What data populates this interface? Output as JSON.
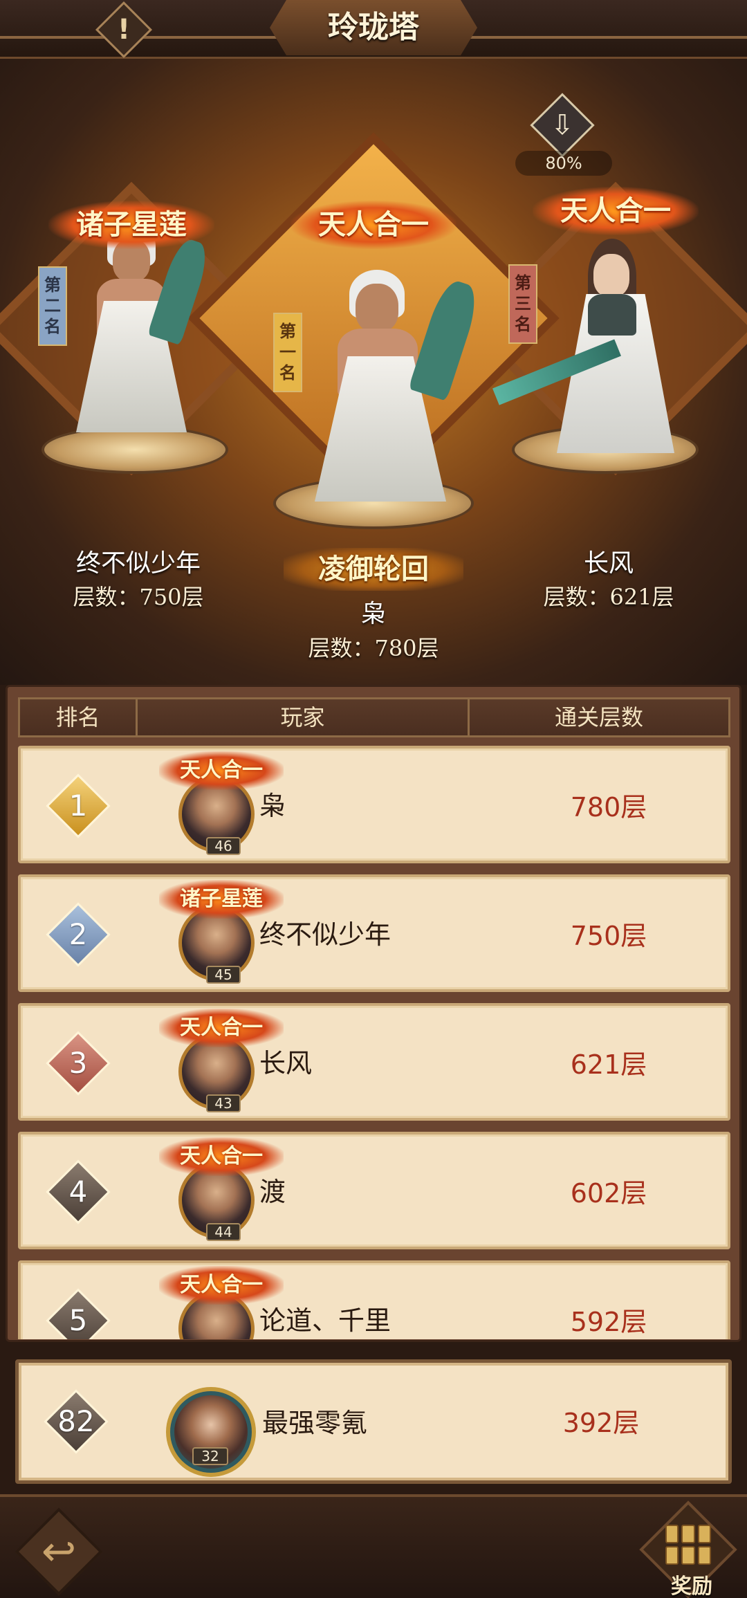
{
  "header": {
    "title": "玲珑塔",
    "alert_icon": "exclamation-icon"
  },
  "podium": {
    "progress_label": "80%",
    "progress_value": 80,
    "arrow_icon": "download-arrow-icon",
    "first": {
      "rank_tag": "第一名",
      "badge": "天人合一",
      "title_banner": "凌御轮回",
      "name": "枭",
      "floors": "层数：780层"
    },
    "second": {
      "rank_tag": "第二名",
      "badge": "诸子星莲",
      "name": "终不似少年",
      "floors": "层数：750层"
    },
    "third": {
      "rank_tag": "第三名",
      "badge": "天人合一",
      "name": "长风",
      "floors": "层数：621层"
    }
  },
  "table": {
    "headers": {
      "rank": "排名",
      "player": "玩家",
      "floors": "通关层数"
    },
    "rows": [
      {
        "rank": "1",
        "badge_style": "gold",
        "title": "天人合一",
        "level": "46",
        "name": "枭",
        "floors": "780层"
      },
      {
        "rank": "2",
        "badge_style": "blue",
        "title": "诸子星莲",
        "level": "45",
        "name": "终不似少年",
        "floors": "750层"
      },
      {
        "rank": "3",
        "badge_style": "red",
        "title": "天人合一",
        "level": "43",
        "name": "长风",
        "floors": "621层"
      },
      {
        "rank": "4",
        "badge_style": "grey",
        "title": "天人合一",
        "level": "44",
        "name": "渡",
        "floors": "602层"
      },
      {
        "rank": "5",
        "badge_style": "grey",
        "title": "天人合一",
        "level": "",
        "name": "论道、千里",
        "floors": "592层"
      }
    ]
  },
  "my_rank": {
    "rank": "82",
    "level": "32",
    "name": "最强零氪",
    "floors": "392层"
  },
  "footer": {
    "back_icon": "back-arrow-icon",
    "reward_icon": "treasure-icon",
    "reward_label": "奖励"
  },
  "colors": {
    "floor_text": "#a8301c",
    "row_bg": "#f4e2c4",
    "gold": "#c9901e"
  }
}
